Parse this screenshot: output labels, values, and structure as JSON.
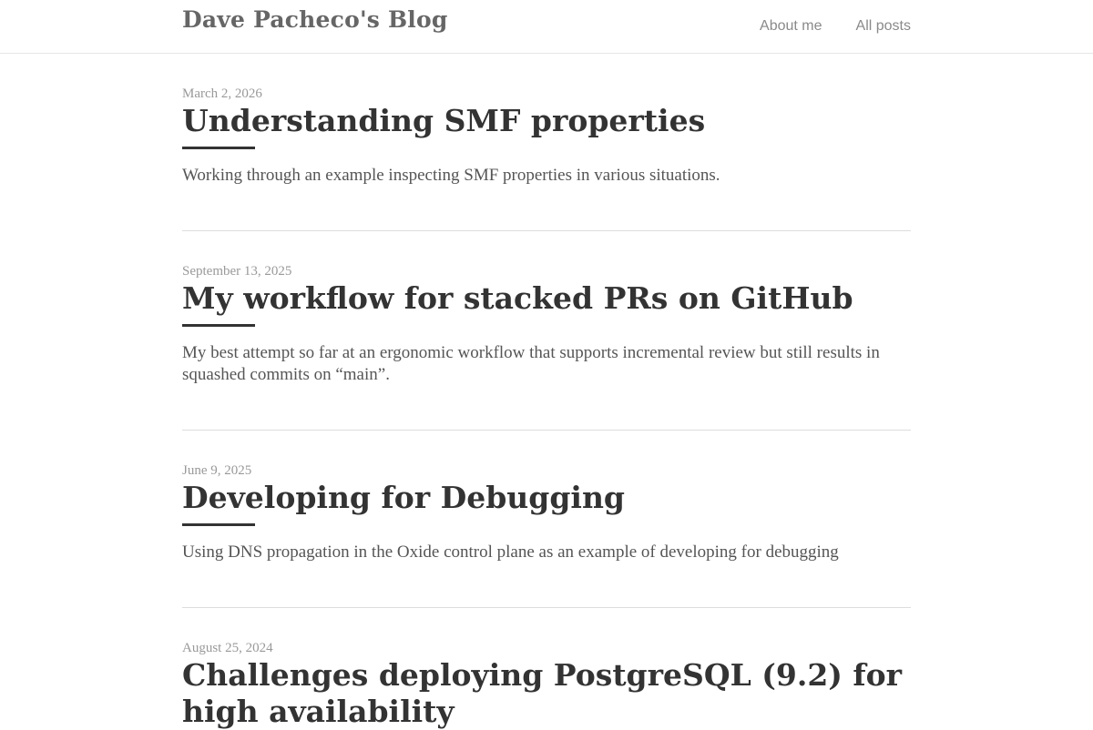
{
  "header": {
    "site_title": "Dave Pacheco's Blog",
    "nav": [
      {
        "label": "About me"
      },
      {
        "label": "All posts"
      }
    ]
  },
  "posts": [
    {
      "date": "March 2, 2026",
      "title": "Understanding SMF properties",
      "summary": "Working through an example inspecting SMF properties in various situations."
    },
    {
      "date": "September 13, 2025",
      "title": "My workflow for stacked PRs on GitHub",
      "summary": "My best attempt so far at an ergonomic workflow that supports incremental review but still results in squashed commits on “main”."
    },
    {
      "date": "June 9, 2025",
      "title": "Developing for Debugging",
      "summary": "Using DNS propagation in the Oxide control plane as an example of developing for debugging"
    },
    {
      "date": "August 25, 2024",
      "title": "Challenges deploying PostgreSQL (9.2) for high availability",
      "summary": ""
    }
  ],
  "colors": {
    "text": "#333333",
    "muted": "#999999",
    "nav": "#8a8a8a",
    "rule": "#dddddd"
  }
}
